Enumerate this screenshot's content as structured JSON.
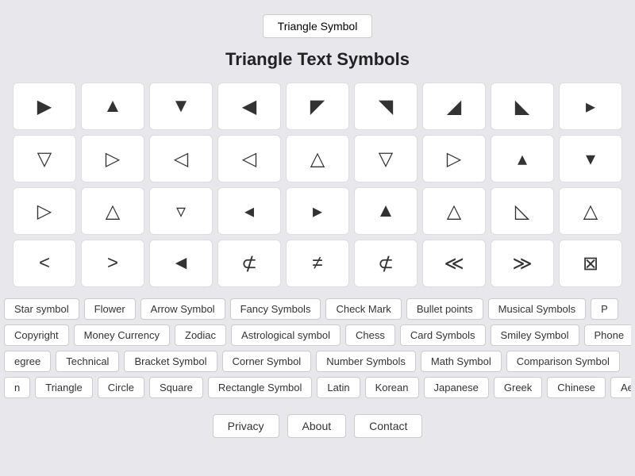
{
  "header": {
    "top_button": "Triangle Symbol",
    "title": "Triangle Text Symbols"
  },
  "symbols": {
    "rows": [
      [
        "▶",
        "▲",
        "▼",
        "◀",
        "◤",
        "◥",
        "◢",
        "◣",
        "▶"
      ],
      [
        "▽",
        "▷",
        "◁",
        "◁",
        "△",
        "▽",
        "▷",
        "▴",
        "▾"
      ],
      [
        "▷",
        "△",
        "▿",
        "◂",
        "▸",
        "▲",
        "△",
        "◺",
        "△"
      ],
      [
        "<",
        ">",
        "◄",
        "⊄",
        "≠",
        "⊄",
        "≪",
        "≫",
        "⊠"
      ]
    ]
  },
  "nav_rows": [
    [
      "Star symbol",
      "Flower",
      "Arrow Symbol",
      "Fancy Symbols",
      "Check Mark",
      "Bullet points",
      "Musical Symbols",
      "P"
    ],
    [
      "Copyright",
      "Money Currency",
      "Zodiac",
      "Astrological symbol",
      "Chess",
      "Card Symbols",
      "Smiley Symbol",
      "Phone"
    ],
    [
      "egree",
      "Technical",
      "Bracket Symbol",
      "Corner Symbol",
      "Number Symbols",
      "Math Symbol",
      "Comparison Symbol"
    ],
    [
      "n",
      "Triangle",
      "Circle",
      "Square",
      "Rectangle Symbol",
      "Latin",
      "Korean",
      "Japanese",
      "Greek",
      "Chinese",
      "Aestho"
    ]
  ],
  "footer": {
    "privacy": "Privacy",
    "about": "About",
    "contact": "Contact"
  }
}
